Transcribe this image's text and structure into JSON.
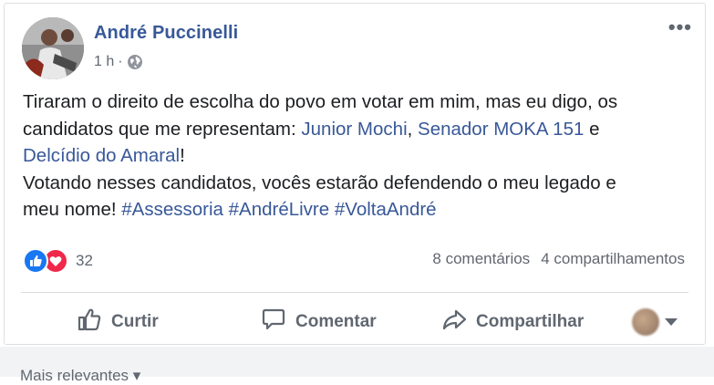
{
  "post": {
    "author": "André Puccinelli",
    "time": "1 h",
    "time_separator": "·",
    "privacy_icon": "globe-icon",
    "more_label": "•••",
    "text": {
      "line1": "Tiraram o direito de escolha do povo em votar em mim, mas eu digo, os",
      "line2_prefix": "candidatos que me representam: ",
      "mention1": "Junior Mochi",
      "comma": ", ",
      "mention2": "Senador MOKA 151",
      "and": " e",
      "mention3": "Delcídio do Amaral",
      "exclaim": "!",
      "line4": "Votando nesses candidatos, vocês estarão defendendo o meu legado e",
      "line5_prefix": "meu nome! ",
      "hashtag1": "#Assessoria",
      "hashtag2": "#AndréLivre",
      "hashtag3": "#VoltaAndré"
    },
    "reactions": {
      "icons": [
        "like-icon",
        "love-icon"
      ],
      "count": "32"
    },
    "comments_count": "8 comentários",
    "shares_count": "4 compartilhamentos"
  },
  "actions": {
    "like": "Curtir",
    "comment": "Comentar",
    "share": "Compartilhar"
  },
  "footer": {
    "sort_label": "Mais relevantes ▾"
  },
  "colors": {
    "link": "#385898",
    "meta": "#606770",
    "like": "#1877f2",
    "love": "#f0284a"
  }
}
